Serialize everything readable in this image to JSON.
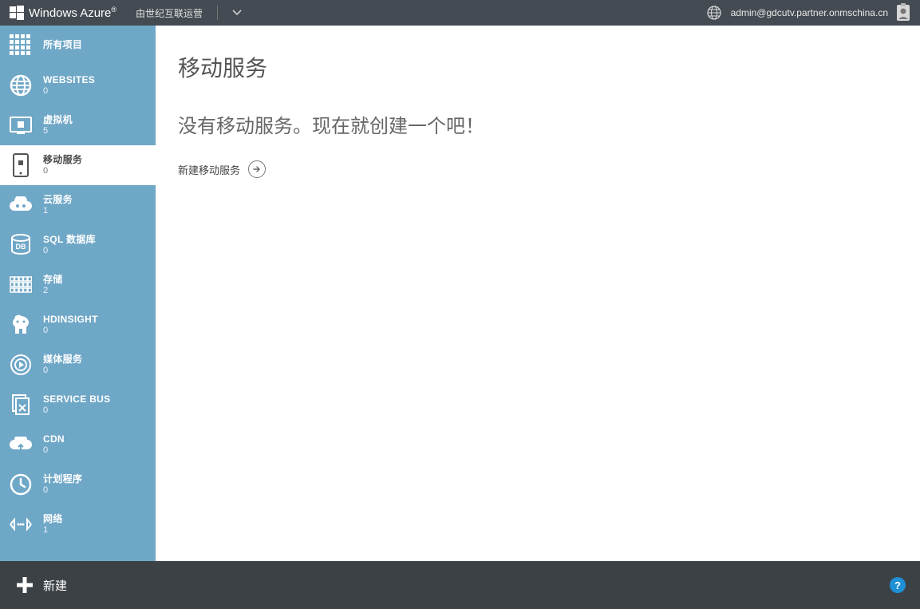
{
  "header": {
    "brand": "Windows Azure",
    "sub_brand": "由世纪互联运营",
    "user_email": "admin@gdcutv.partner.onmschina.cn"
  },
  "sidebar": {
    "items": [
      {
        "label": "所有项目",
        "count": "",
        "icon": "grid",
        "selected": false
      },
      {
        "label": "WEBSITES",
        "count": "0",
        "icon": "websites",
        "selected": false
      },
      {
        "label": "虚拟机",
        "count": "5",
        "icon": "vm",
        "selected": false
      },
      {
        "label": "移动服务",
        "count": "0",
        "icon": "mobile",
        "selected": true
      },
      {
        "label": "云服务",
        "count": "1",
        "icon": "cloud",
        "selected": false
      },
      {
        "label": "SQL 数据库",
        "count": "0",
        "icon": "sql",
        "selected": false
      },
      {
        "label": "存储",
        "count": "2",
        "icon": "storage",
        "selected": false
      },
      {
        "label": "HDINSIGHT",
        "count": "0",
        "icon": "hdinsight",
        "selected": false
      },
      {
        "label": "媒体服务",
        "count": "0",
        "icon": "media",
        "selected": false
      },
      {
        "label": "SERVICE BUS",
        "count": "0",
        "icon": "servicebus",
        "selected": false
      },
      {
        "label": "CDN",
        "count": "0",
        "icon": "cdn",
        "selected": false
      },
      {
        "label": "计划程序",
        "count": "0",
        "icon": "scheduler",
        "selected": false
      },
      {
        "label": "网络",
        "count": "1",
        "icon": "network",
        "selected": false
      }
    ]
  },
  "main": {
    "title": "移动服务",
    "empty_message": "没有移动服务。现在就创建一个吧！",
    "create_link": "新建移动服务"
  },
  "footer": {
    "new_label": "新建"
  }
}
